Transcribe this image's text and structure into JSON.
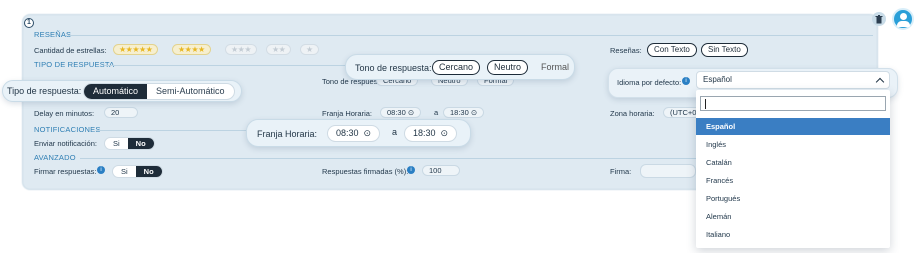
{
  "panel": {
    "index": "1",
    "sections": {
      "resenas": "RESEÑAS",
      "tipo": "TIPO DE RESPUESTA",
      "notificaciones": "NOTIFICACIONES",
      "avanzado": "AVANZADO"
    },
    "stars_label": "Cantidad de estrellas:",
    "star_buttons": [
      "★★★★★",
      "★★★★",
      "★★★",
      "★★",
      "★"
    ],
    "resenas_label": "Reseñas:",
    "resenas_options": [
      "Con Texto",
      "Sin Texto"
    ],
    "tono_label_bg": "Tono de respuesta:",
    "tono_bg_options": [
      "Cercano",
      "Neutro",
      "Formal"
    ],
    "delay_label": "Delay en minutos:",
    "delay_value": "20",
    "franja_label": "Franja Horaria:",
    "franja_from": "08:30",
    "franja_sep": "a",
    "franja_to": "18:30",
    "zona_label": "Zona horaria:",
    "zona_value": "(UTC+0",
    "notif_label": "Enviar notificación:",
    "notif_options": [
      "Si",
      "No"
    ],
    "firmar_label": "Firmar respuestas:",
    "firmar_options": [
      "Si",
      "No"
    ],
    "firmadas_label": "Respuestas firmadas (%):",
    "firmadas_value": "100",
    "firma_label": "Firma:"
  },
  "tipo_callout": {
    "label": "Tipo de respuesta:",
    "options": [
      "Automático",
      "Semi-Automático"
    ],
    "selected": "Automático"
  },
  "tono_callout": {
    "label": "Tono de respuesta:",
    "options": [
      "Cercano",
      "Neutro",
      "Formal"
    ]
  },
  "franja_callout": {
    "label": "Franja Horaria:",
    "from": "08:30",
    "sep": "a",
    "to": "18:30"
  },
  "idioma": {
    "label": "Idioma por defecto:",
    "selected": "Español",
    "search_value": "",
    "options": [
      "Español",
      "Inglés",
      "Catalán",
      "Francés",
      "Portugués",
      "Alemán",
      "Italiano"
    ]
  },
  "colors": {
    "accent": "#2a9fd8",
    "dark": "#1e2c39",
    "selected_item": "#3a7ec3",
    "star": "#e8b722"
  }
}
